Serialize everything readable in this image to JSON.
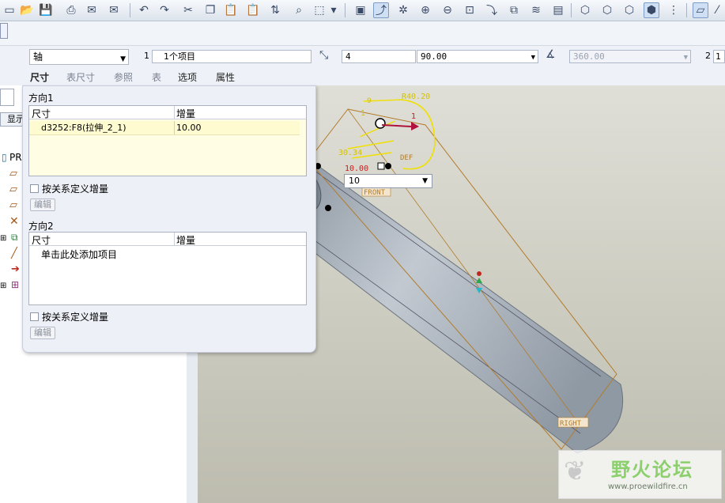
{
  "dashboard": {
    "type_selector": "轴",
    "num_1": "1",
    "items_field": "1个项目",
    "count_field": "4",
    "angle_combo": "90.00",
    "total_angle": "360.00",
    "num_2": "2",
    "num_2b": "1",
    "tabs": [
      "尺寸",
      "表尺寸",
      "参照",
      "表",
      "选项",
      "属性"
    ]
  },
  "panel": {
    "dir1_title": "方向1",
    "dir1_col_dim": "尺寸",
    "dir1_col_inc": "增量",
    "dir1_row_dim": "d3252:F8(拉伸_2_1)",
    "dir1_row_inc": "10.00",
    "rel_label_1": "按关系定义增量",
    "edit_btn_1": "编辑",
    "dir2_title": "方向2",
    "dir2_col_dim": "尺寸",
    "dir2_col_inc": "增量",
    "dir2_placeholder": "单击此处添加项目",
    "rel_label_2": "按关系定义增量",
    "edit_btn_2": "编辑"
  },
  "tree": {
    "show_label": "显示",
    "root_label": "PR"
  },
  "viewport": {
    "value_dropdown": "10",
    "dim_r": "R40.20",
    "dim_val": "10.00",
    "dim_small": "30.34",
    "dim_1a": "1",
    "dim_1b": "1",
    "dim_9": "9",
    "plane_front": "FRONT",
    "plane_def": "DEF",
    "plane_right": "RIGHT"
  },
  "watermark": {
    "title": "野火论坛",
    "url": "www.proewildfire.cn"
  }
}
